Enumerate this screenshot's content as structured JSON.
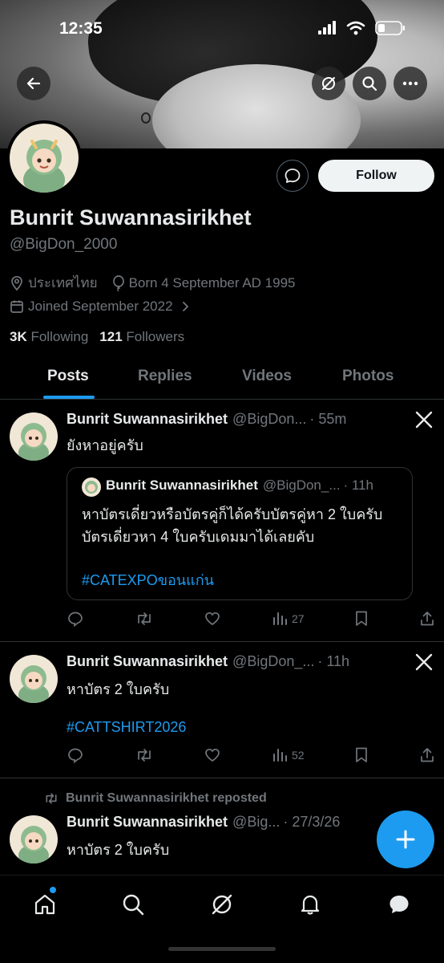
{
  "status_bar": {
    "time": "12:35"
  },
  "profile": {
    "display_name": "Bunrit Suwannasirikhet",
    "handle": "@BigDon_2000",
    "location": "ประเทศไทย",
    "birthday": "Born 4 September AD 1995",
    "joined": "Joined September 2022",
    "following_count": "3K",
    "following_label": "Following",
    "followers_count": "121",
    "followers_label": "Followers",
    "follow_button": "Follow"
  },
  "tabs": [
    {
      "label": "Posts",
      "active": true
    },
    {
      "label": "Replies",
      "active": false
    },
    {
      "label": "Videos",
      "active": false
    },
    {
      "label": "Photos",
      "active": false
    }
  ],
  "posts": [
    {
      "name": "Bunrit Suwannasirikhet",
      "handle": "@BigDon...",
      "time": "· 55m",
      "text": "ยังหาอยู่ครับ",
      "quote": {
        "name": "Bunrit Suwannasirikhet",
        "handle": "@BigDon_...",
        "time": "· 11h",
        "line1": "หาบัตรเดี่ยวหรือบัตรคู่ก็ได้ครับบัตรคู่หา 2 ใบครับ",
        "line2": "บัตรเดี่ยวหา 4 ใบครับเดมมาได้เลยคับ",
        "hashtag": "#CATEXPOขอนแก่น"
      },
      "views": "27"
    },
    {
      "name": "Bunrit Suwannasirikhet",
      "handle": "@BigDon_...",
      "time": "· 11h",
      "text": "หาบัตร 2 ใบครับ",
      "hashtag": "#CATTSHIRT2026",
      "views": "52"
    },
    {
      "repost_label": "Bunrit Suwannasirikhet reposted",
      "name": "Bunrit Suwannasirikhet",
      "handle": "@Big...",
      "time": "· 27/3/26",
      "text": "หาบัตร 2 ใบครับ"
    }
  ],
  "colors": {
    "accent": "#1d9bf0",
    "background": "#000000",
    "muted": "#71767b",
    "text": "#e7e9ea"
  }
}
